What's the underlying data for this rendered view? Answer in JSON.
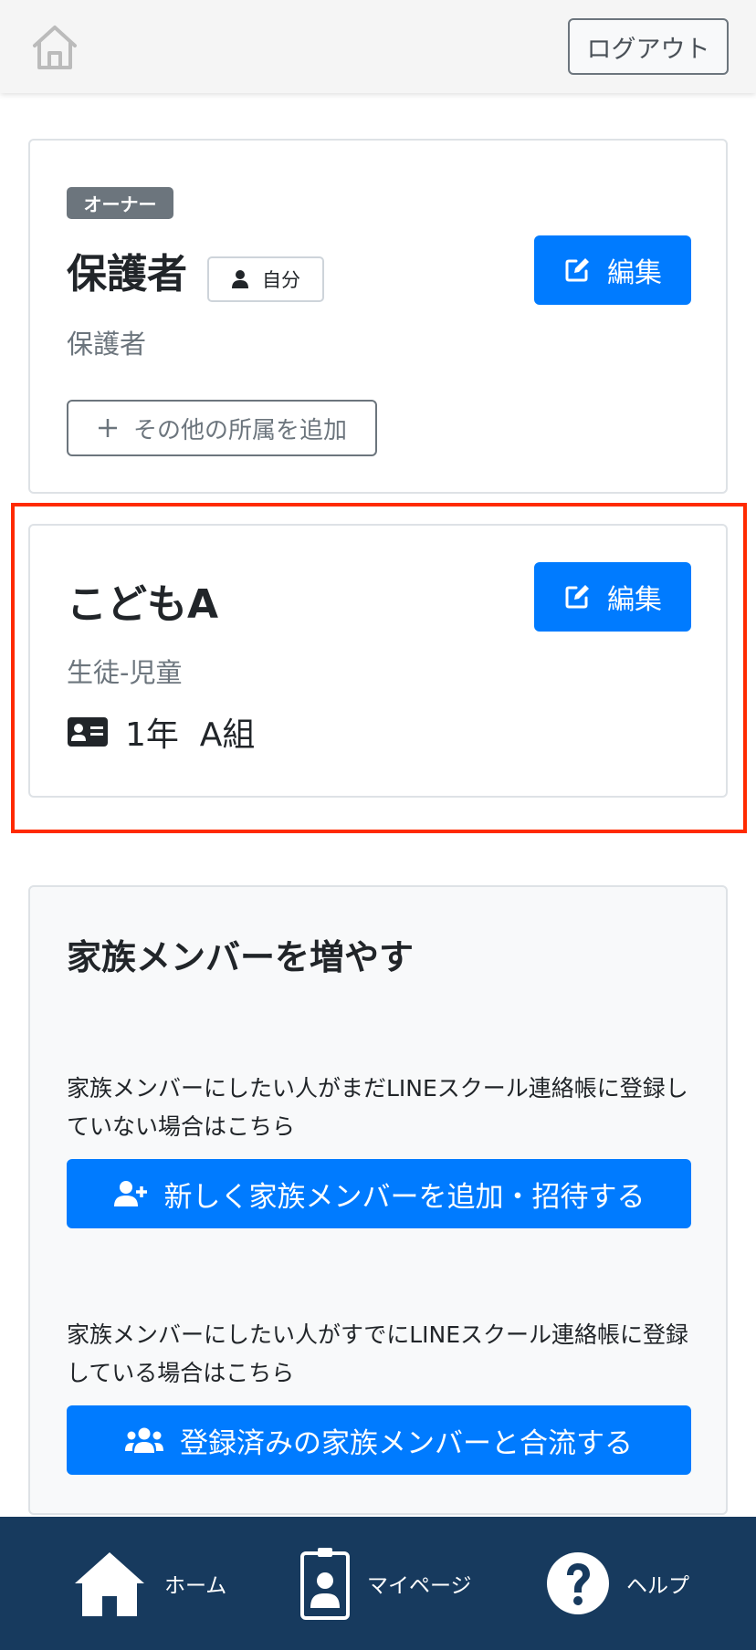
{
  "header": {
    "logout_label": "ログアウト"
  },
  "guardian_card": {
    "owner_badge": "オーナー",
    "name": "保護者",
    "self_badge": "自分",
    "edit_label": "編集",
    "role": "保護者",
    "add_affiliation_label": "その他の所属を追加"
  },
  "child_card": {
    "name": "こどもA",
    "edit_label": "編集",
    "role": "生徒-児童",
    "class_label": "1年  A組"
  },
  "family_section": {
    "title": "家族メンバーを増やす",
    "new_desc": "家族メンバーにしたい人がまだLINEスクール連絡帳に登録していない場合はこちら",
    "new_button": "新しく家族メンバーを追加・招待する",
    "merge_desc": "家族メンバーにしたい人がすでにLINEスクール連絡帳に登録している場合はこちら",
    "merge_button": "登録済みの家族メンバーと合流する"
  },
  "bottom_nav": {
    "home": "ホーム",
    "mypage": "マイページ",
    "help": "ヘルプ"
  },
  "colors": {
    "primary": "#007bff",
    "nav_bg": "#173a5e",
    "highlight": "#ff2a00",
    "badge_gray": "#6c757d"
  },
  "icons": [
    "home-outline-icon",
    "user-icon",
    "edit-icon",
    "plus-icon",
    "id-card-icon",
    "user-plus-icon",
    "users-icon",
    "home-icon",
    "id-badge-icon",
    "question-circle-icon"
  ]
}
